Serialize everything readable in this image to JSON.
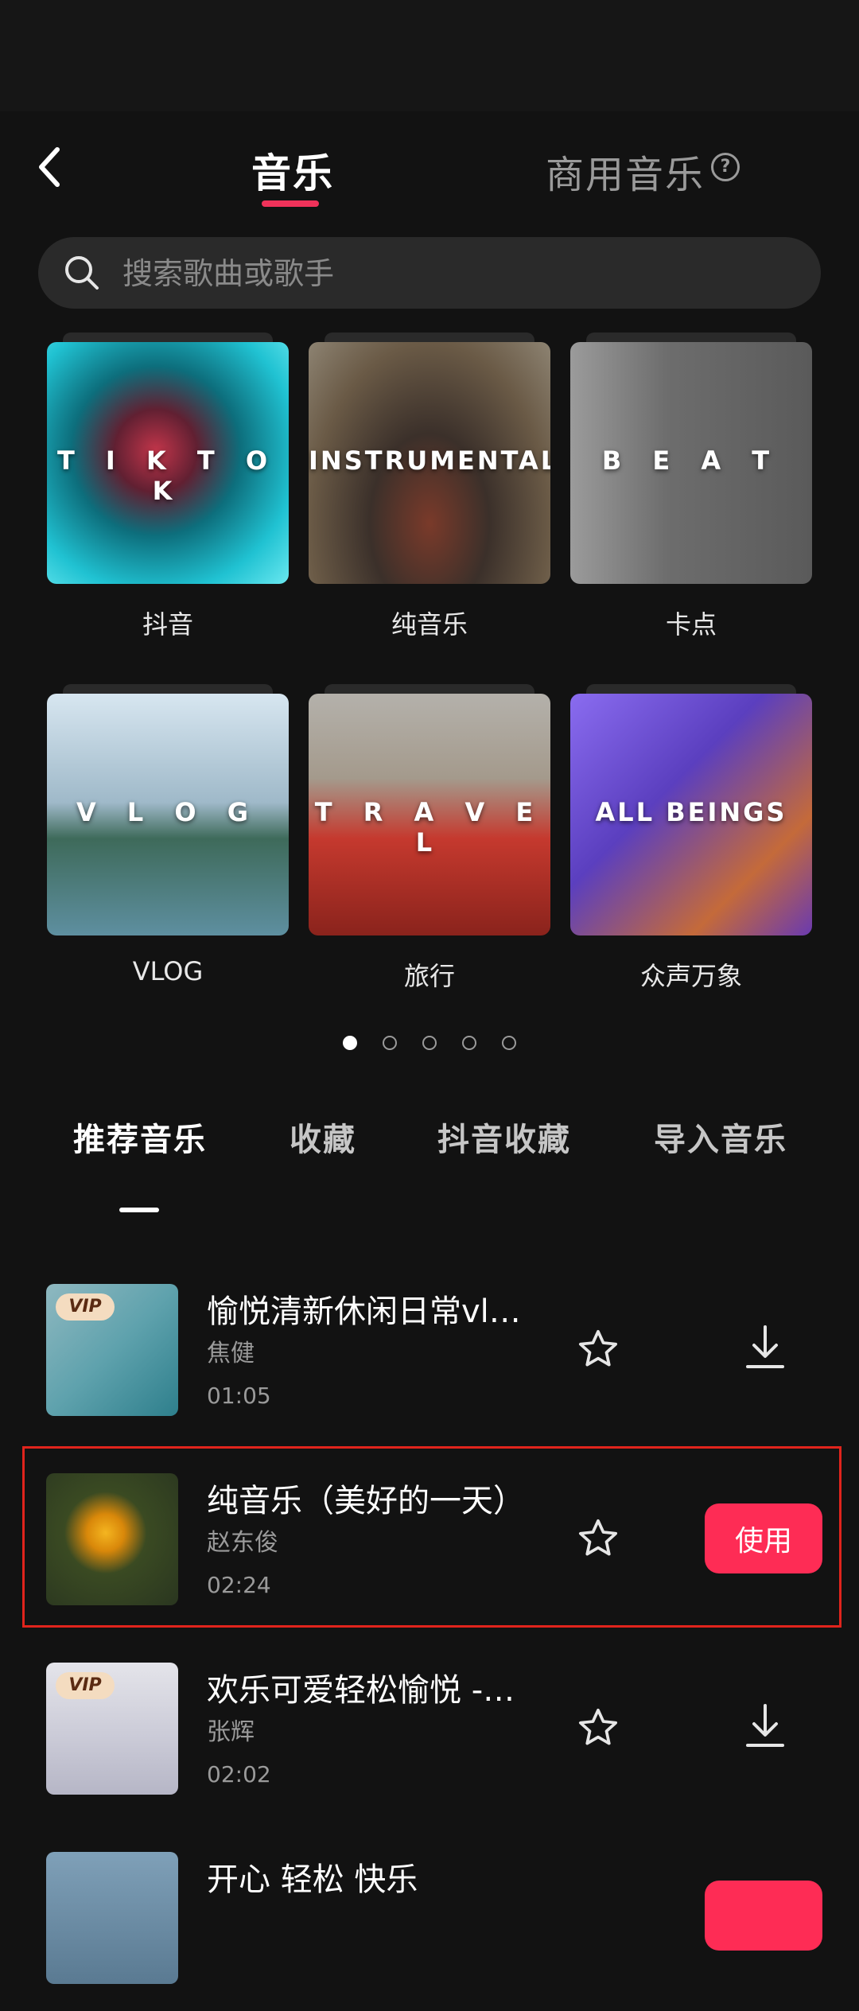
{
  "header": {
    "tab_music": "音乐",
    "tab_commercial": "商用音乐",
    "help_glyph": "?"
  },
  "search": {
    "placeholder": "搜索歌曲或歌手"
  },
  "categories": [
    {
      "overlay": "T I K T O K",
      "label": "抖音"
    },
    {
      "overlay": "INSTRUMENTAL",
      "label": "纯音乐"
    },
    {
      "overlay": "B E A T",
      "label": "卡点"
    },
    {
      "overlay": "V L O G",
      "label": "VLOG"
    },
    {
      "overlay": "T R A V E L",
      "label": "旅行"
    },
    {
      "overlay": "ALL BEINGS",
      "label": "众声万象"
    }
  ],
  "pager": {
    "total": 5,
    "active_index": 0
  },
  "section_tabs": [
    {
      "label": "推荐音乐",
      "active": true
    },
    {
      "label": "收藏",
      "active": false
    },
    {
      "label": "抖音收藏",
      "active": false
    },
    {
      "label": "导入音乐",
      "active": false
    }
  ],
  "songs": [
    {
      "title": "愉悦清新休闲日常vl…",
      "artist": "焦健",
      "duration": "01:05",
      "vip": "VIP",
      "action": "download"
    },
    {
      "title": "纯音乐（美好的一天）",
      "artist": "赵东俊",
      "duration": "02:24",
      "vip": "",
      "action": "use",
      "action_label": "使用",
      "highlighted": true
    },
    {
      "title": "欢乐可爱轻松愉悦 -…",
      "artist": "张辉",
      "duration": "02:02",
      "vip": "VIP",
      "action": "download"
    },
    {
      "title": "开心 轻松 快乐",
      "artist": "",
      "duration": "",
      "vip": "",
      "action": "use"
    }
  ],
  "colors": {
    "background": "#121212",
    "accent": "#fe2c55",
    "tab_underline": "#f0325a",
    "highlight_border": "#e0241c",
    "muted_text": "#9a9a9a"
  },
  "icons": {
    "back": "chevron-left-icon",
    "help": "question-circle-icon",
    "search": "search-icon",
    "favorite": "star-outline-icon",
    "download": "download-icon"
  }
}
